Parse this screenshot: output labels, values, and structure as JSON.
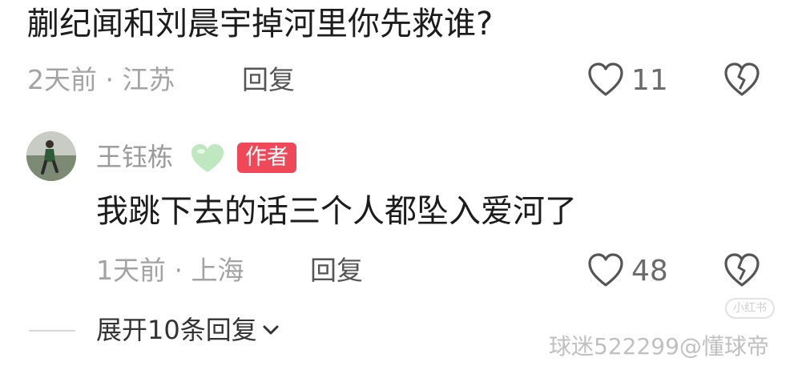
{
  "comment1": {
    "text": "蒯纪闻和刘晨宇掉河里你先救谁?",
    "meta": "2天前 · 江苏",
    "reply_label": "回复",
    "like_count": "11"
  },
  "comment2": {
    "username": "王钰栋",
    "badge": "作者",
    "text": "我跳下去的话三个人都坠入爱河了",
    "meta": "1天前 · 上海",
    "reply_label": "回复",
    "like_count": "48"
  },
  "expand": {
    "label": "展开10条回复"
  },
  "watermark": "球迷522299@懂球帝",
  "faint_logo": "小红书",
  "icons": {
    "like": "heart-outline-icon",
    "dislike": "broken-heart-icon",
    "username_emoji": "green-heart-icon",
    "expand": "chevron-down-icon"
  },
  "colors": {
    "badge": "#f04759",
    "green_heart": "#bfe8c0"
  }
}
